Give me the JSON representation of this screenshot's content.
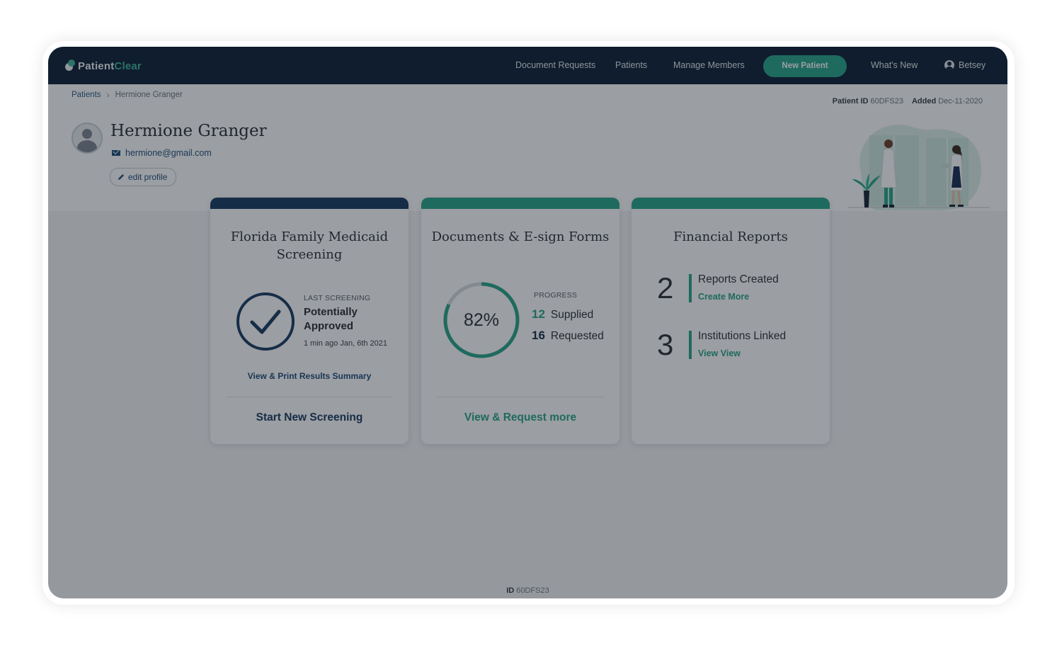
{
  "colors": {
    "navy": "#0f2237",
    "teal": "#2aa58a",
    "link_blue": "#1f4e7d",
    "card1_bar": "#1b3d63",
    "card_bar_teal": "#2aa58a",
    "ring_track": "#d7dbdf"
  },
  "app": {
    "logo_part1": "Patient",
    "logo_part2": "Clear"
  },
  "nav": {
    "document_requests": "Document Requests",
    "patients": "Patients",
    "manage_members": "Manage Members",
    "new_patient": "New Patient",
    "whats_new": "What's New",
    "user_name": "Betsey",
    "user_icon": "user-circle-icon"
  },
  "breadcrumb": {
    "root": "Patients",
    "separator": "›",
    "current": "Hermione Granger"
  },
  "patient": {
    "id_label": "Patient ID",
    "id_value": "60DFS23",
    "added_label": "Added",
    "added_value": "Dec-11-2020",
    "name": "Hermione Granger",
    "email": "hermione@gmail.com",
    "edit_label": "edit profile"
  },
  "cards": {
    "screening": {
      "title": "Florida Family Medicaid Screening",
      "last_label": "LAST SCREENING",
      "status": "Potentially Approved",
      "time": "1 min ago Jan, 6th 2021",
      "summary_link": "View  & Print Results Summary",
      "footer": "Start New Screening",
      "icon": "check-circle-icon"
    },
    "documents": {
      "title": "Documents & E-sign Forms",
      "progress_percent": 82,
      "progress_text": "82%",
      "progress_label": "PROGRESS",
      "supplied_count": "12",
      "supplied_label": "Supplied",
      "requested_count": "16",
      "requested_label": "Requested",
      "footer": "View & Request more"
    },
    "financial": {
      "title": "Financial Reports",
      "reports_count": "2",
      "reports_label": "Reports Created",
      "reports_link": "Create  More",
      "institutions_count": "3",
      "institutions_label": "Institutions Linked",
      "institutions_link": "View View"
    }
  },
  "footer": {
    "id_label": "ID",
    "id_value": "60DFS23"
  }
}
